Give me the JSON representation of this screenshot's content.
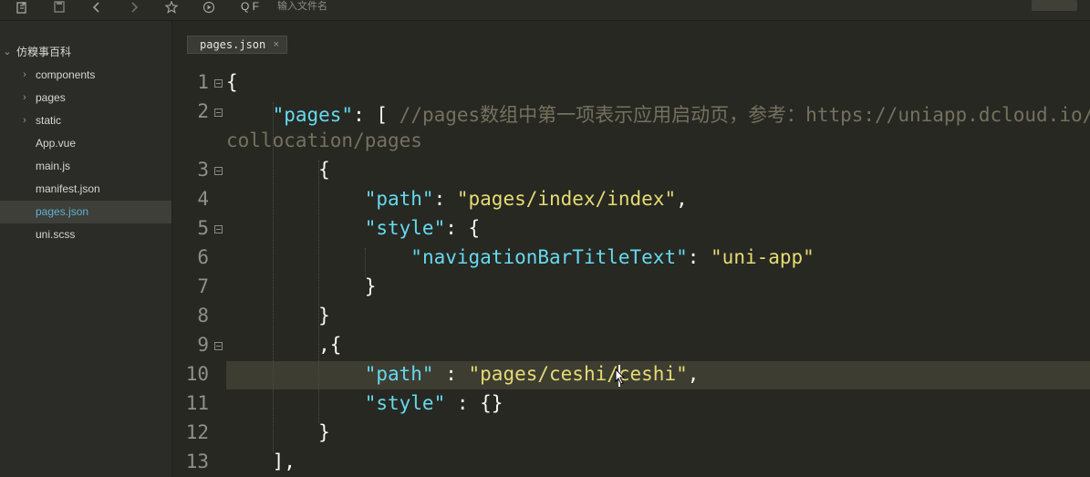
{
  "toolbar": {
    "icons": [
      "new-file-icon",
      "save-icon",
      "back-icon",
      "forward-icon",
      "star-icon",
      "run-icon"
    ],
    "search_icon_text": "Q F",
    "search_placeholder": "输入文件名"
  },
  "sidebar": {
    "project": "仿糗事百科",
    "items": [
      {
        "label": "components",
        "type": "folder"
      },
      {
        "label": "pages",
        "type": "folder"
      },
      {
        "label": "static",
        "type": "folder"
      },
      {
        "label": "App.vue",
        "type": "file"
      },
      {
        "label": "main.js",
        "type": "file"
      },
      {
        "label": "manifest.json",
        "type": "file"
      },
      {
        "label": "pages.json",
        "type": "file",
        "selected": true
      },
      {
        "label": "uni.scss",
        "type": "file"
      }
    ]
  },
  "editor": {
    "tab": {
      "label": "pages.json",
      "close": "×"
    },
    "line_numbers": [
      "1",
      "2",
      "3",
      "4",
      "5",
      "6",
      "7",
      "8",
      "9",
      "10",
      "11",
      "12",
      "13"
    ],
    "lines": [
      {
        "n": "1",
        "tokens": [
          {
            "t": "p",
            "v": "{"
          }
        ]
      },
      {
        "n": "2",
        "tokens": [
          {
            "t": "p",
            "v": "    "
          },
          {
            "t": "k",
            "v": "\"pages\""
          },
          {
            "t": "p",
            "v": ": [ "
          },
          {
            "t": "c",
            "v": "//pages数组中第一项表示应用启动页，参考：https://uniapp.dcloud.io/"
          }
        ]
      },
      {
        "n": "",
        "tokens": [
          {
            "t": "c",
            "v": "collocation/pages"
          }
        ]
      },
      {
        "n": "3",
        "tokens": [
          {
            "t": "p",
            "v": "        {"
          }
        ]
      },
      {
        "n": "4",
        "tokens": [
          {
            "t": "p",
            "v": "            "
          },
          {
            "t": "k",
            "v": "\"path\""
          },
          {
            "t": "p",
            "v": ": "
          },
          {
            "t": "s",
            "v": "\"pages/index/index\""
          },
          {
            "t": "p",
            "v": ","
          }
        ]
      },
      {
        "n": "5",
        "tokens": [
          {
            "t": "p",
            "v": "            "
          },
          {
            "t": "k",
            "v": "\"style\""
          },
          {
            "t": "p",
            "v": ": {"
          }
        ]
      },
      {
        "n": "6",
        "tokens": [
          {
            "t": "p",
            "v": "                "
          },
          {
            "t": "k",
            "v": "\"navigationBarTitleText\""
          },
          {
            "t": "p",
            "v": ": "
          },
          {
            "t": "s",
            "v": "\"uni-app\""
          }
        ]
      },
      {
        "n": "7",
        "tokens": [
          {
            "t": "p",
            "v": "            }"
          }
        ]
      },
      {
        "n": "8",
        "tokens": [
          {
            "t": "p",
            "v": "        }"
          }
        ]
      },
      {
        "n": "9",
        "tokens": [
          {
            "t": "p",
            "v": "        ,{"
          }
        ]
      },
      {
        "n": "10",
        "tokens": [
          {
            "t": "p",
            "v": "            "
          },
          {
            "t": "k",
            "v": "\"path\""
          },
          {
            "t": "p",
            "v": " : "
          },
          {
            "t": "s",
            "v": "\"pages/ceshi/ceshi\""
          },
          {
            "t": "p",
            "v": ","
          }
        ]
      },
      {
        "n": "11",
        "tokens": [
          {
            "t": "p",
            "v": "            "
          },
          {
            "t": "k",
            "v": "\"style\""
          },
          {
            "t": "p",
            "v": " : {}"
          }
        ]
      },
      {
        "n": "12",
        "tokens": [
          {
            "t": "p",
            "v": "        }"
          }
        ]
      },
      {
        "n": "13",
        "tokens": [
          {
            "t": "p",
            "v": "    ],"
          }
        ]
      }
    ]
  },
  "colors": {
    "background": "#272822",
    "keyword": "#66d9ef",
    "string": "#e6db74",
    "comment": "#75715e",
    "selected_file": "#5fb0d8"
  }
}
